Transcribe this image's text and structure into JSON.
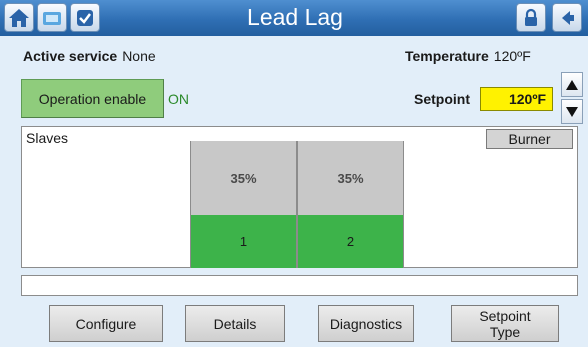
{
  "header": {
    "title": "Lead Lag",
    "icons": [
      "home-icon",
      "screen-icon",
      "check-icon",
      "lock-icon",
      "back-icon"
    ]
  },
  "status_row": {
    "active_service_label": "Active service",
    "active_service_value": "None",
    "temperature_label": "Temperature",
    "temperature_value": "120ºF"
  },
  "controls": {
    "operation_enable_label": "Operation enable",
    "operation_state": "ON",
    "setpoint_label": "Setpoint",
    "setpoint_value": "120ºF"
  },
  "slaves_panel": {
    "label": "Slaves",
    "burner_button": "Burner",
    "slaves": [
      {
        "percent": "35%",
        "id": "1"
      },
      {
        "percent": "35%",
        "id": "2"
      }
    ]
  },
  "footer": {
    "configure": "Configure",
    "details": "Details",
    "diagnostics": "Diagnostics",
    "setpoint_type_line1": "Setpoint",
    "setpoint_type_line2": "Type"
  },
  "colors": {
    "title_bar": "#2f6fb4",
    "operation_button": "#8fcc7c",
    "setpoint_field": "#fff200",
    "slave_active": "#3db34a",
    "slave_rate": "#c8c8c8"
  }
}
